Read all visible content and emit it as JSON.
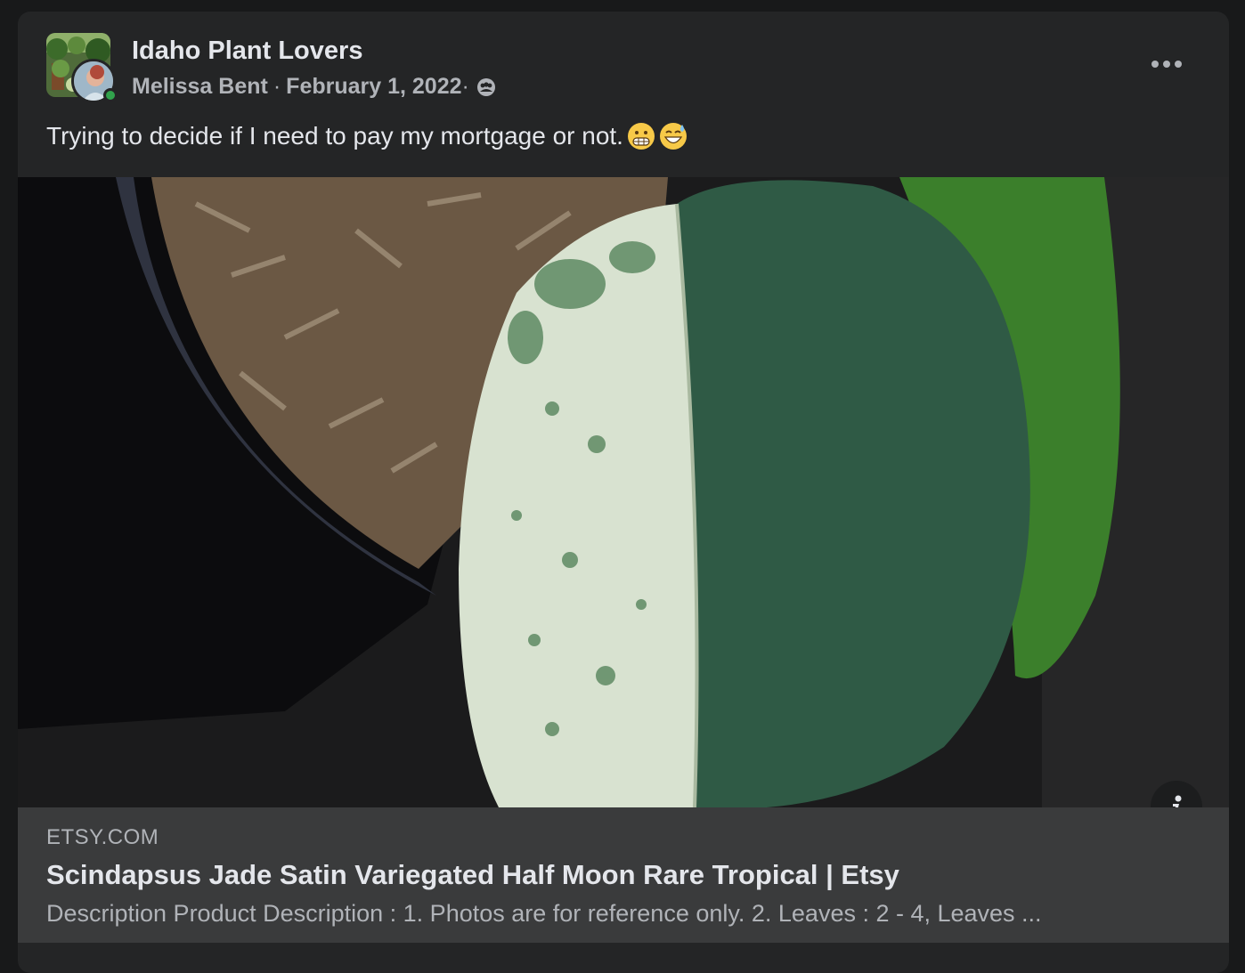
{
  "post": {
    "group_name": "Idaho Plant Lovers",
    "author": "Melissa Bent",
    "separator": "·",
    "date": "February 1, 2022",
    "date_suffix": "·",
    "privacy_icon": "group-members-icon",
    "more_icon": "more-horizontal-icon",
    "text": "Trying to decide if I need to pay my mortgage or not.",
    "emojis": [
      "grimacing-face-emoji",
      "grinning-sweat-emoji"
    ]
  },
  "link": {
    "image_alt": "Scindapsus Jade Satin variegated half moon leaf",
    "info_icon": "info-icon",
    "domain": "ETSY.COM",
    "title": "Scindapsus Jade Satin Variegated Half Moon Rare Tropical | Etsy",
    "description": "Description Product Description : 1. Photos are for reference only. 2. Leaves : 2 - 4, Leaves ..."
  },
  "colors": {
    "card_bg": "#242526",
    "page_bg": "#18191a",
    "preview_bg": "#3a3b3c",
    "primary_text": "#e4e6eb",
    "secondary_text": "#b0b3b8",
    "online": "#31a24c"
  }
}
